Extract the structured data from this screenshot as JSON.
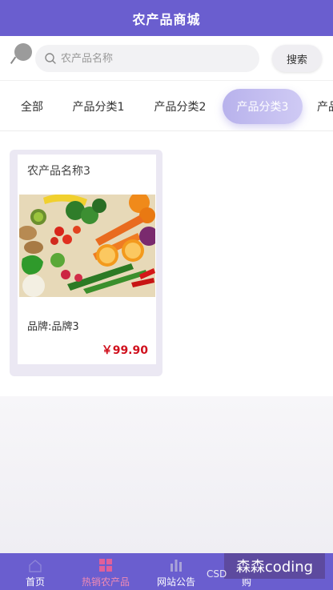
{
  "header": {
    "title": "农产品商城"
  },
  "search": {
    "placeholder": "农产品名称",
    "button_label": "搜索"
  },
  "tabs": [
    {
      "label": "全部"
    },
    {
      "label": "产品分类1"
    },
    {
      "label": "产品分类2"
    },
    {
      "label": "产品分类3",
      "active": true
    },
    {
      "label": "产品"
    }
  ],
  "products": [
    {
      "name": "农产品名称3",
      "brand": "品牌:品牌3",
      "price": "￥99.90"
    }
  ],
  "bottom_nav": [
    {
      "label": "首页"
    },
    {
      "label": "热销农产品"
    },
    {
      "label": "网站公告"
    },
    {
      "label": "购"
    }
  ],
  "watermark": {
    "text": "森森coding",
    "prefix": "CSD"
  },
  "colors": {
    "primary": "#6a5ecf",
    "price": "#d0101d",
    "tab_active": "#bfb9ef"
  }
}
